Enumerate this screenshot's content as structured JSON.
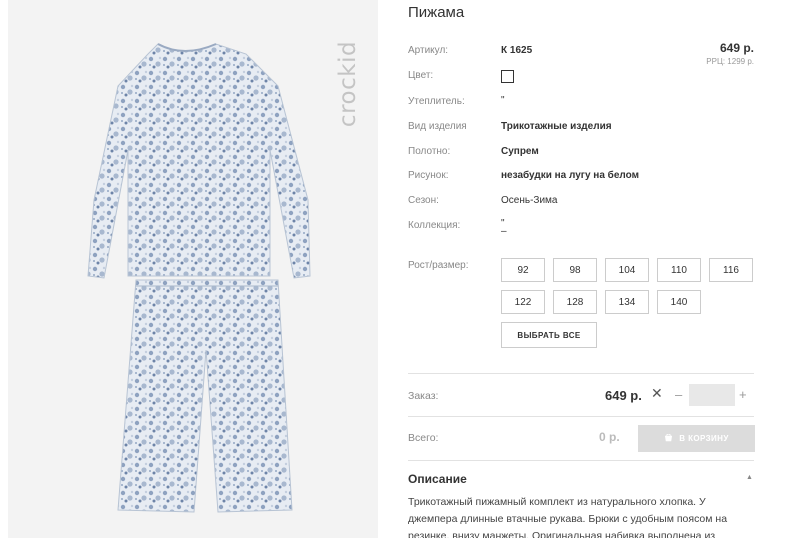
{
  "brand": "crockid",
  "product": {
    "title": "Пижама",
    "price": "649 р.",
    "rrp": "РРЦ: 1299 р."
  },
  "specs": {
    "article": {
      "label": "Артикул:",
      "value": "К 1625"
    },
    "color": {
      "label": "Цвет:"
    },
    "insulation": {
      "label": "Утеплитель:",
      "value": "\""
    },
    "type": {
      "label": "Вид изделия",
      "value": "Трикотажные изделия"
    },
    "fabric": {
      "label": "Полотно:",
      "value": "Супрем"
    },
    "pattern": {
      "label": "Рисунок:",
      "value": "незабудки на лугу на белом"
    },
    "season": {
      "label": "Сезон:",
      "value": "Осень-Зима"
    },
    "collection": {
      "label": "Коллекция:",
      "value": "\"",
      "value2": "–"
    }
  },
  "sizes": {
    "label": "Рост/размер:",
    "options": [
      "92",
      "98",
      "104",
      "110",
      "116",
      "122",
      "128",
      "134",
      "140"
    ],
    "select_all": "ВЫБРАТЬ ВСЕ"
  },
  "order": {
    "label": "Заказ:",
    "price": "649 р.",
    "times": "✕",
    "minus": "–",
    "plus": "+",
    "quantity": ""
  },
  "total": {
    "label": "Всего:",
    "value": "0 р.",
    "cart_button": "В КОРЗИНУ"
  },
  "description": {
    "title": "Описание",
    "toggle": "▲",
    "text": "Трикотажный пижамный комплект из натурального хлопка. У джемпера длинные втачные рукава. Брюки с удобным поясом на резинке, внизу манжеты. Оригинальная набивка выполнена из"
  },
  "colors": {
    "print_light": "#dfe6ef",
    "print_dark": "#7d93b4",
    "button_disabled": "#dcdcdc"
  },
  "icons": {
    "cart": "cart-icon",
    "brand_logo": "crockid-logo"
  }
}
